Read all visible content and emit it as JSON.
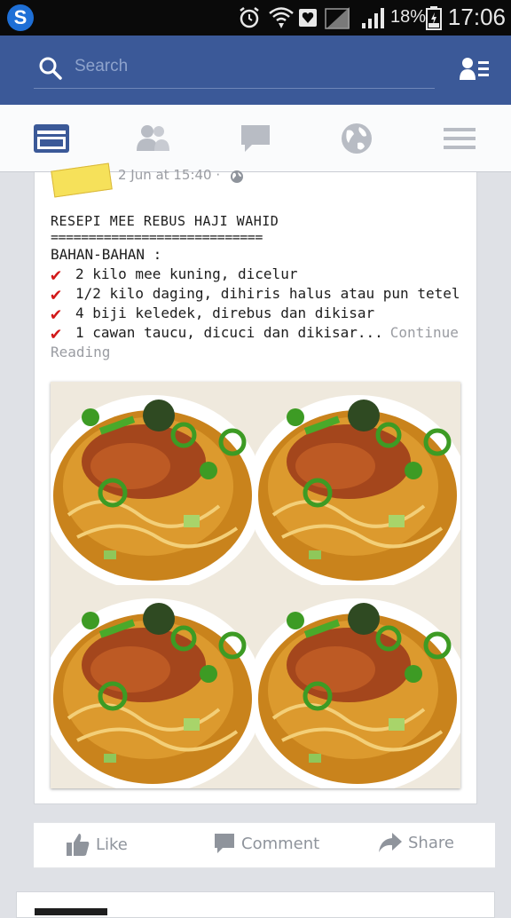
{
  "status_bar": {
    "battery_percent": "18%",
    "time": "17:06"
  },
  "header": {
    "search_placeholder": "Search",
    "icons": [
      "search-icon",
      "friends-list-icon"
    ]
  },
  "tabs": [
    {
      "name": "news-feed",
      "icon": "news-feed-icon",
      "active": true
    },
    {
      "name": "friend-requests",
      "icon": "friends-icon",
      "active": false
    },
    {
      "name": "messages",
      "icon": "chat-bubble-icon",
      "active": false
    },
    {
      "name": "notifications",
      "icon": "globe-icon",
      "active": false
    },
    {
      "name": "more",
      "icon": "menu-icon",
      "active": false
    }
  ],
  "post": {
    "timestamp": "2 Jun at 15:40 ·",
    "title": "RESEPI MEE REBUS HAJI WAHID",
    "separator": "============================",
    "section_label": "BAHAN-BAHAN :",
    "ingredients": [
      "2 kilo mee kuning, dicelur",
      "1/2 kilo daging, dihiris halus atau pun tetel",
      "4 biji keledek, direbus dan dikisar",
      "1 cawan taucu, dicuci dan dikisar..."
    ],
    "continue_label": "Continue",
    "reading_label": "Reading"
  },
  "actions": {
    "like_label": "Like",
    "comment_label": "Comment",
    "share_label": "Share"
  },
  "colors": {
    "facebook_blue": "#3b5998",
    "check_red": "#d11a1a",
    "muted_text": "#9a9ca2"
  }
}
